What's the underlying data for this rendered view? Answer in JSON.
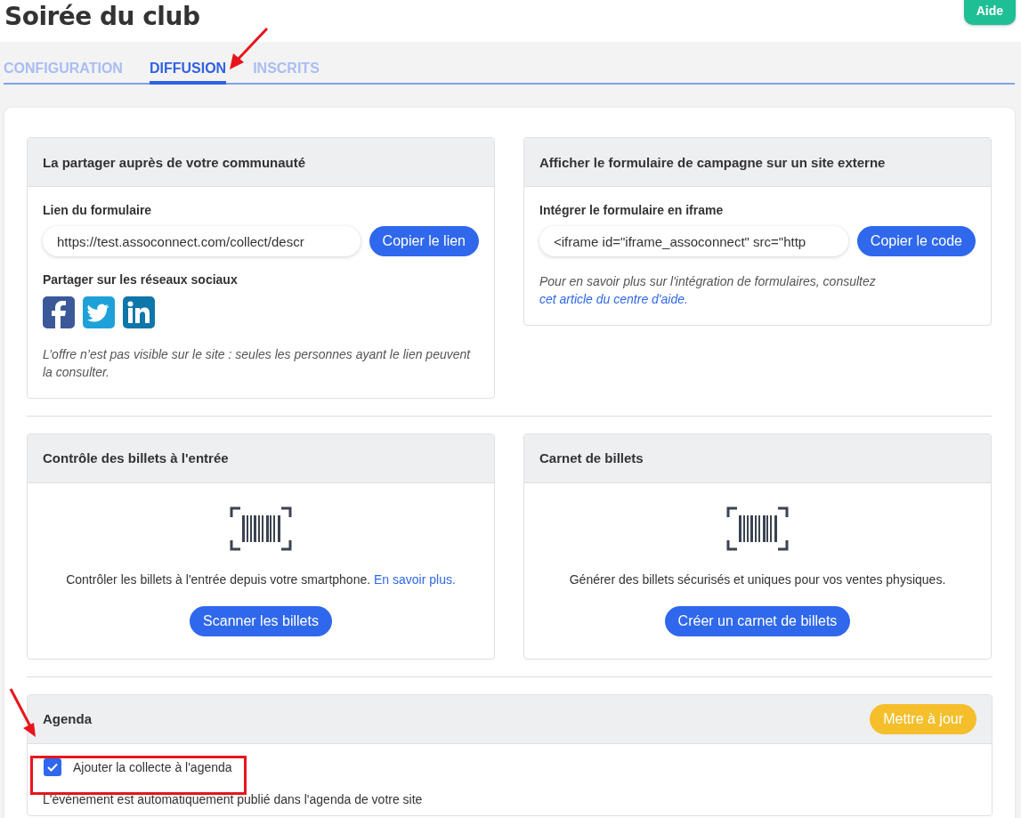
{
  "page": {
    "title": "Soirée du club",
    "help_button": "Aide"
  },
  "tabs": [
    {
      "label": "CONFIGURATION",
      "selected": false
    },
    {
      "label": "DIFFUSION",
      "selected": true
    },
    {
      "label": "INSCRITS",
      "selected": false
    }
  ],
  "share_panel": {
    "title": "La partager auprès de votre communauté",
    "link_label": "Lien du formulaire",
    "link_value": "https://test.assoconnect.com/collect/descr",
    "copy_button": "Copier le lien",
    "social_label": "Partager sur les réseaux sociaux",
    "note": "L’offre n’est pas visible sur le site : seules les personnes ayant le lien peuvent la consulter."
  },
  "embed_panel": {
    "title": "Afficher le formulaire de campagne sur un site externe",
    "iframe_label": "Intégrer le formulaire en iframe",
    "iframe_value": "<iframe id=\"iframe_assoconnect\" src=\"http",
    "copy_button": "Copier le code",
    "note": "Pour en savoir plus sur l'intégration de formulaires, consultez ",
    "note_link": "cet article du centre d'aide."
  },
  "ticket_panels": [
    {
      "title": "Contrôle des billets à l'entrée",
      "text": "Contrôler les billets à l'entrée depuis votre smartphone. ",
      "link": "En savoir plus.",
      "button": "Scanner les billets"
    },
    {
      "title": "Carnet de billets",
      "text": "Générer des billets sécurisés et uniques pour vos ventes physiques.",
      "button": "Créer un carnet de billets"
    }
  ],
  "agenda": {
    "title": "Agenda",
    "update_button": "Mettre à jour",
    "checkbox_label": "Ajouter la collecte à l'agenda",
    "checked": true,
    "description": "L'événement est automatiquement publié dans l'agenda de votre site"
  }
}
